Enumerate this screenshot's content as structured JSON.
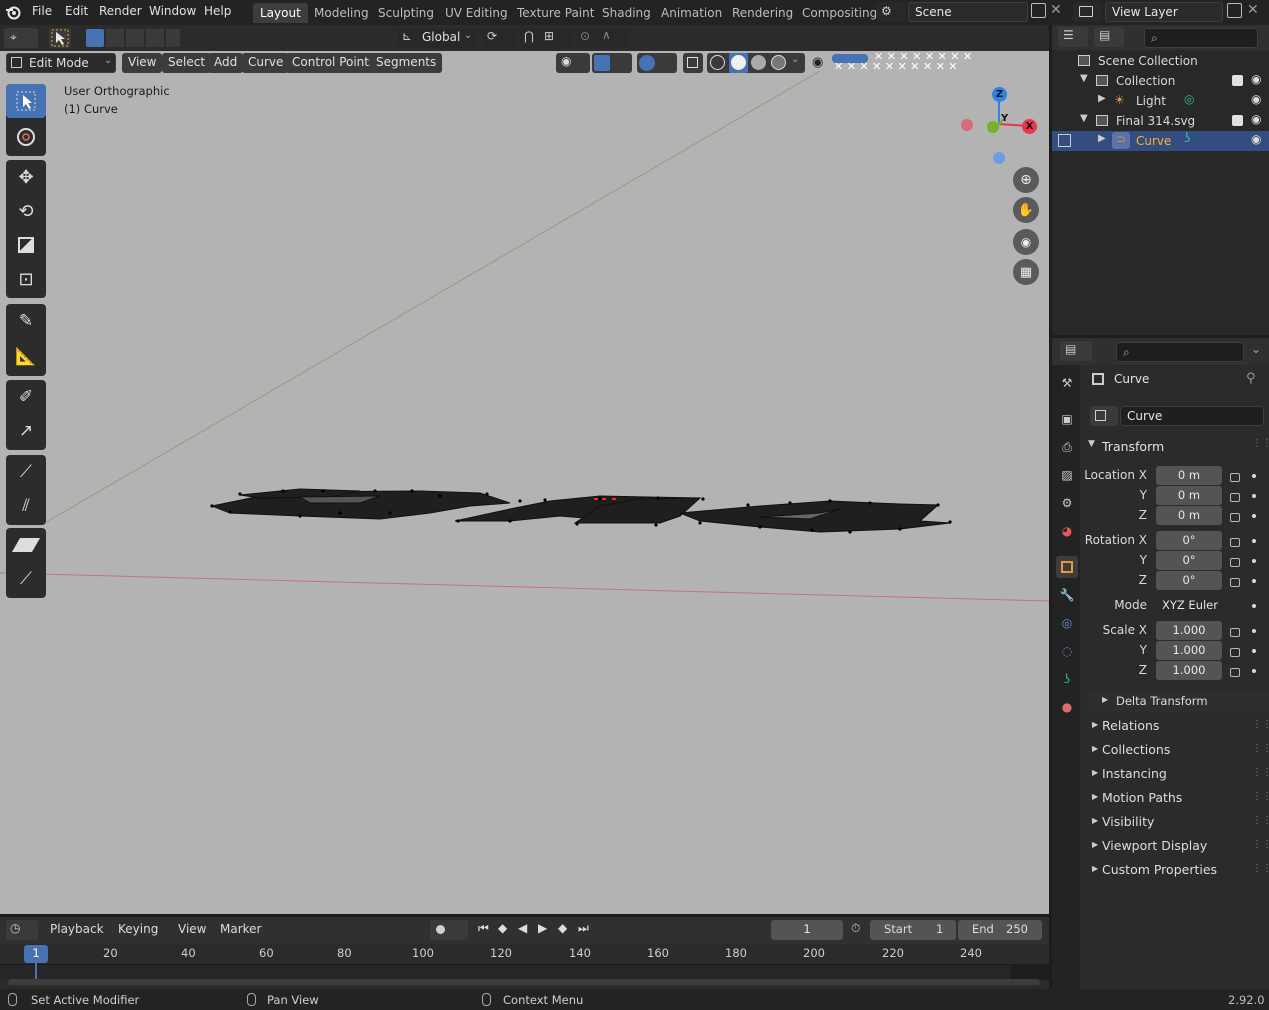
{
  "topbar": {
    "menus": [
      "File",
      "Edit",
      "Render",
      "Window",
      "Help"
    ],
    "workspaces": [
      "Layout",
      "Modeling",
      "Sculpting",
      "UV Editing",
      "Texture Paint",
      "Shading",
      "Animation",
      "Rendering",
      "Compositing"
    ],
    "active_workspace": "Layout",
    "scene_name": "Scene",
    "view_layer": "View Layer"
  },
  "viewport_header": {
    "mode": "Edit Mode",
    "menus": [
      "View",
      "Select",
      "Add",
      "Curve",
      "Control Points",
      "Segments"
    ],
    "transform_orientation": "Global"
  },
  "viewport": {
    "view_name": "User Orthographic",
    "object_label": "(1) Curve",
    "background": "#b3b3b3",
    "axis_labels": {
      "z": "Z",
      "y": "Y",
      "x": "X"
    },
    "axis_colors": {
      "x": "#e8354a",
      "y": "#77b02c",
      "z": "#2f83e6"
    }
  },
  "outliner": {
    "root": "Scene Collection",
    "items": [
      {
        "label": "Collection",
        "level": 1
      },
      {
        "label": "Light",
        "level": 2
      },
      {
        "label": "Final 314.svg",
        "level": 1
      },
      {
        "label": "Curve",
        "level": 2,
        "selected": true
      }
    ]
  },
  "properties": {
    "object_name": "Curve",
    "datablock_name": "Curve",
    "transform_title": "Transform",
    "location_label": "Location X",
    "rotation_label": "Rotation X",
    "scale_label": "Scale X",
    "axis_y": "Y",
    "axis_z": "Z",
    "location": [
      "0 m",
      "0 m",
      "0 m"
    ],
    "rotation": [
      "0°",
      "0°",
      "0°"
    ],
    "mode_label": "Mode",
    "mode_value": "XYZ Euler",
    "scale": [
      "1.000",
      "1.000",
      "1.000"
    ],
    "delta_transform": "Delta Transform",
    "panels": [
      "Relations",
      "Collections",
      "Instancing",
      "Motion Paths",
      "Visibility",
      "Viewport Display",
      "Custom Properties"
    ]
  },
  "timeline": {
    "menus": [
      "Playback",
      "Keying",
      "View",
      "Marker"
    ],
    "current_frame": "1",
    "start_label": "Start",
    "start": "1",
    "end_label": "End",
    "end": "250",
    "ruler": [
      1,
      20,
      40,
      60,
      80,
      100,
      120,
      140,
      160,
      180,
      200,
      220,
      240
    ]
  },
  "statusbar": {
    "hints": [
      "Set Active Modifier",
      "Pan View",
      "Context Menu"
    ],
    "version": "2.92.0"
  }
}
